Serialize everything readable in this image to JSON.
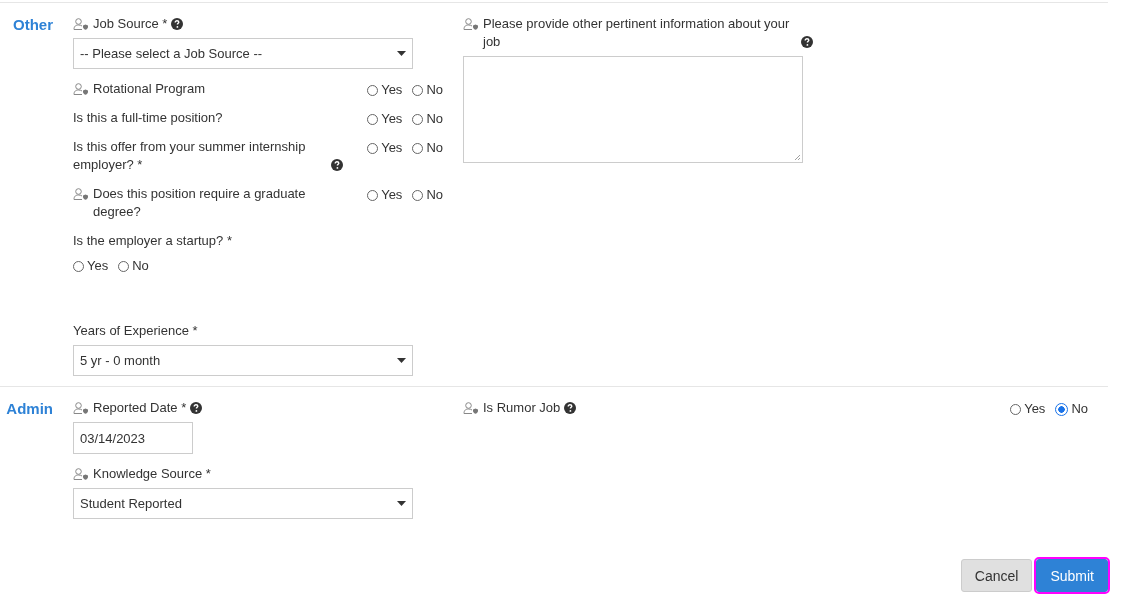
{
  "sections": [
    {
      "title": "Other",
      "left": [
        {
          "kind": "select",
          "label": "Job Source *",
          "user_icon": true,
          "help": true,
          "value": "-- Please select a Job Source --"
        },
        {
          "kind": "radio_row",
          "label": "Rotational Program",
          "user_icon": true,
          "help": false,
          "options": [
            {
              "label": "Yes",
              "selected": false
            },
            {
              "label": "No",
              "selected": false
            }
          ]
        },
        {
          "kind": "radio_row",
          "label": "Is this a full-time position?",
          "user_icon": false,
          "help": false,
          "options": [
            {
              "label": "Yes",
              "selected": false
            },
            {
              "label": "No",
              "selected": false
            }
          ]
        },
        {
          "kind": "radio_row",
          "label": "Is this offer from your summer internship employer? *",
          "user_icon": false,
          "help": true,
          "options": [
            {
              "label": "Yes",
              "selected": false
            },
            {
              "label": "No",
              "selected": false
            }
          ]
        },
        {
          "kind": "radio_row",
          "label": "Does this position require a graduate degree?",
          "user_icon": true,
          "help": false,
          "options": [
            {
              "label": "Yes",
              "selected": false
            },
            {
              "label": "No",
              "selected": false
            }
          ]
        },
        {
          "kind": "radio_below",
          "label": "Is the employer a startup? *",
          "user_icon": false,
          "help": false,
          "options": [
            {
              "label": "Yes",
              "selected": false
            },
            {
              "label": "No",
              "selected": false
            }
          ]
        },
        {
          "kind": "select",
          "label": "Years of Experience *",
          "user_icon": false,
          "help": false,
          "value": "5 yr - 0 month"
        }
      ],
      "right": [
        {
          "kind": "textarea",
          "label": "Please provide other pertinent information about your job",
          "user_icon": true,
          "help": true
        }
      ]
    },
    {
      "title": "Admin",
      "left": [
        {
          "kind": "date",
          "label": "Reported Date *",
          "user_icon": true,
          "help": true,
          "value": "03/14/2023"
        },
        {
          "kind": "select",
          "label": "Knowledge Source *",
          "user_icon": true,
          "help": false,
          "value": "Student Reported"
        }
      ],
      "right": [
        {
          "kind": "radio_row",
          "label": "Is Rumor Job",
          "user_icon": true,
          "help": true,
          "options": [
            {
              "label": "Yes",
              "selected": false
            },
            {
              "label": "No",
              "selected": true
            }
          ]
        }
      ]
    }
  ],
  "buttons": [
    {
      "label": "Cancel",
      "kind": "secondary",
      "focused": false
    },
    {
      "label": "Submit",
      "kind": "primary",
      "focused": true
    }
  ]
}
